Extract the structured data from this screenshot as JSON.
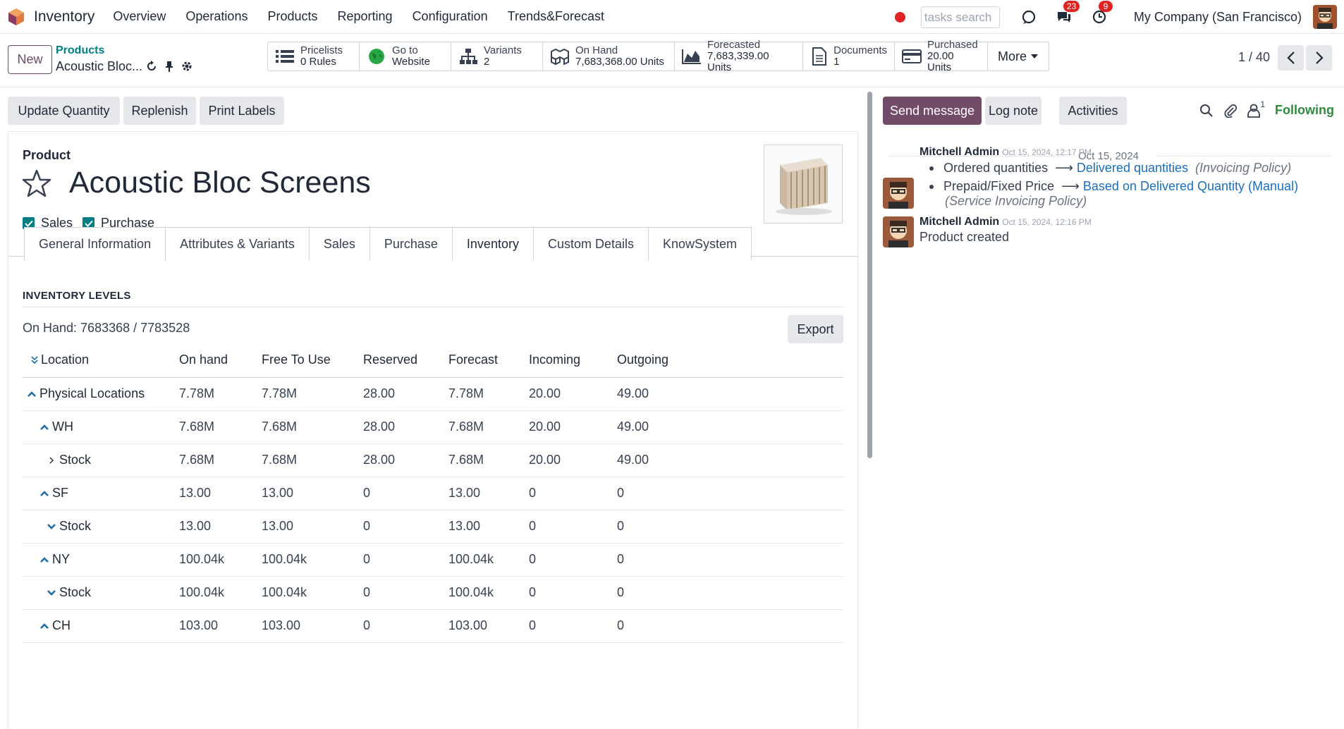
{
  "topbar": {
    "app_name": "Inventory",
    "menu": [
      "Overview",
      "Operations",
      "Products",
      "Reporting",
      "Configuration",
      "Trends&Forecast"
    ],
    "search_placeholder": "tasks search",
    "messages_badge": "23",
    "activities_badge": "9",
    "company": "My Company (San Francisco)"
  },
  "control": {
    "new_label": "New",
    "breadcrumb_parent": "Products",
    "breadcrumb_current": "Acoustic Bloc...",
    "stats": [
      {
        "icon": "list-icon",
        "label": "Pricelists",
        "value": "0 Rules"
      },
      {
        "icon": "globe-icon",
        "label": "Go to",
        "value": "Website"
      },
      {
        "icon": "sitemap-icon",
        "label": "Variants",
        "value": "2"
      },
      {
        "icon": "cubes-icon",
        "label": "On Hand",
        "value": "7,683,368.00 Units"
      },
      {
        "icon": "area-chart-icon",
        "label": "Forecasted",
        "value": "7,683,339.00 Units"
      },
      {
        "icon": "file-icon",
        "label": "Documents",
        "value": "1"
      },
      {
        "icon": "credit-card-icon",
        "label": "Purchased",
        "value": "20.00 Units"
      }
    ],
    "more_label": "More",
    "pager": "1 / 40"
  },
  "form": {
    "actions": [
      "Update Quantity",
      "Replenish",
      "Print Labels"
    ],
    "product_label": "Product",
    "product_name": "Acoustic Bloc Screens",
    "sales_label": "Sales",
    "purchase_label": "Purchase",
    "tabs": [
      "General Information",
      "Attributes & Variants",
      "Sales",
      "Purchase",
      "Inventory",
      "Custom Details",
      "KnowSystem"
    ],
    "active_tab": "Inventory",
    "section_title": "INVENTORY LEVELS",
    "on_hand_summary": "On Hand: 7683368 / 7783528",
    "export_label": "Export",
    "columns": [
      "Location",
      "On hand",
      "Free To Use",
      "Reserved",
      "Forecast",
      "Incoming",
      "Outgoing"
    ],
    "rows": [
      {
        "name": "Physical Locations",
        "level": 0,
        "toggle": "up",
        "values": [
          "7.78M",
          "7.78M",
          "28.00",
          "7.78M",
          "20.00",
          "49.00"
        ]
      },
      {
        "name": "WH",
        "level": 1,
        "toggle": "up",
        "values": [
          "7.68M",
          "7.68M",
          "28.00",
          "7.68M",
          "20.00",
          "49.00"
        ]
      },
      {
        "name": "Stock",
        "level": 2,
        "toggle": "right",
        "values": [
          "7.68M",
          "7.68M",
          "28.00",
          "7.68M",
          "20.00",
          "49.00"
        ]
      },
      {
        "name": "SF",
        "level": 1,
        "toggle": "up",
        "values": [
          "13.00",
          "13.00",
          "0",
          "13.00",
          "0",
          "0"
        ]
      },
      {
        "name": "Stock",
        "level": 2,
        "toggle": "down",
        "values": [
          "13.00",
          "13.00",
          "0",
          "13.00",
          "0",
          "0"
        ]
      },
      {
        "name": "NY",
        "level": 1,
        "toggle": "up",
        "values": [
          "100.04k",
          "100.04k",
          "0",
          "100.04k",
          "0",
          "0"
        ]
      },
      {
        "name": "Stock",
        "level": 2,
        "toggle": "down",
        "values": [
          "100.04k",
          "100.04k",
          "0",
          "100.04k",
          "0",
          "0"
        ]
      },
      {
        "name": "CH",
        "level": 1,
        "toggle": "up",
        "values": [
          "103.00",
          "103.00",
          "0",
          "103.00",
          "0",
          "0"
        ]
      }
    ]
  },
  "chatter": {
    "send_message": "Send message",
    "log_note": "Log note",
    "activities": "Activities",
    "followers_count": "1",
    "following": "Following",
    "date": "Oct 15, 2024",
    "messages": [
      {
        "author": "Mitchell Admin",
        "date": "Oct 15, 2024, 12:17 PM",
        "changes": [
          {
            "from": "Ordered quantities",
            "to": "Delivered quantities",
            "field": "(Invoicing Policy)"
          },
          {
            "from": "Prepaid/Fixed Price",
            "to": "Based on Delivered Quantity (Manual)",
            "field": "(Service Invoicing Policy)"
          }
        ]
      },
      {
        "author": "Mitchell Admin",
        "date": "Oct 15, 2024, 12:16 PM",
        "body": "Product created"
      }
    ]
  },
  "colors": {
    "brand": "#714b67",
    "accent": "#017e84"
  }
}
